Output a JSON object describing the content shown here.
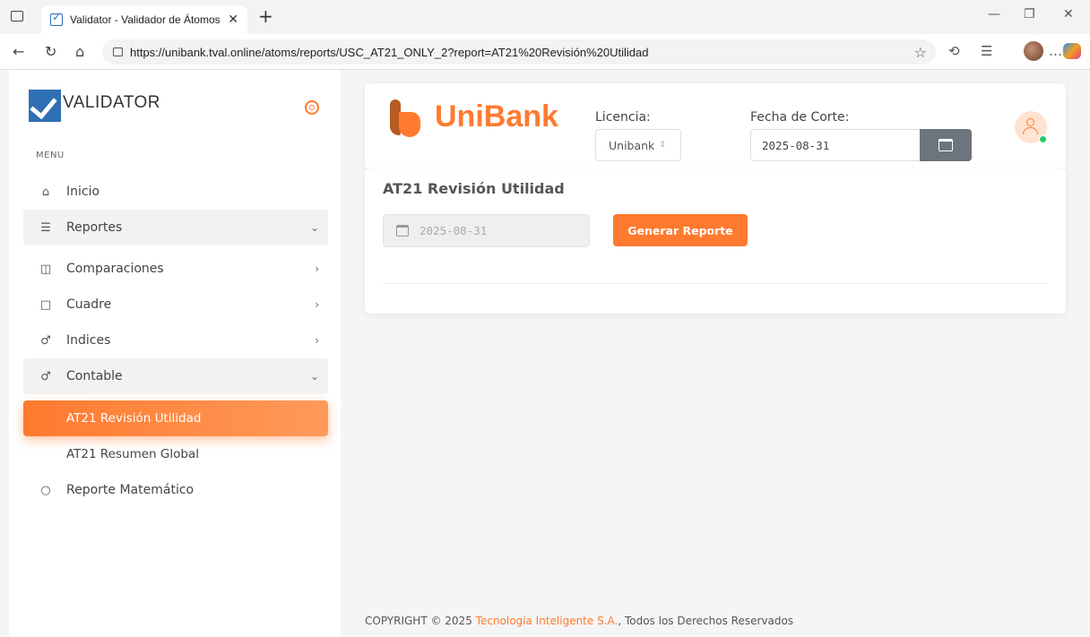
{
  "browser": {
    "tab_title": "Validator - Validador de Átomos",
    "tab_close": "✕",
    "new_tab": "+",
    "url": "https://unibank.tval.online/atoms/reports/USC_AT21_ONLY_2?report=AT21%20Revisión%20Utilidad"
  },
  "sidebar": {
    "logo_text": "VALIDATOR",
    "menu_label": "MENU",
    "items": [
      {
        "label": "Inicio",
        "icon": "home-icon"
      },
      {
        "label": "Reportes",
        "icon": "database-icon"
      },
      {
        "label": "Comparaciones",
        "icon": "columns-icon"
      },
      {
        "label": "Cuadre",
        "icon": "square-icon"
      },
      {
        "label": "Indices",
        "icon": "gender-icon"
      },
      {
        "label": "Contable",
        "icon": "gender-icon"
      },
      {
        "label": "AT21 Revisión Utilidad"
      },
      {
        "label": "AT21 Resumen Global"
      },
      {
        "label": "Reporte Matemático",
        "icon": "circle-icon"
      }
    ]
  },
  "header": {
    "brand": "UniBank",
    "licencia_label": "Licencia:",
    "licencia_value": "Unibank",
    "fecha_label": "Fecha de Corte:",
    "fecha_value": "2025-08-31"
  },
  "report": {
    "title": "AT21 Revisión Utilidad",
    "date_value": "2025-08-31",
    "generate_label": "Generar Reporte"
  },
  "footer": {
    "prefix": "COPYRIGHT © 2025",
    "company": "Tecnología Inteligente S.A.",
    "suffix": ", Todos los Derechos Reservados"
  },
  "colors": {
    "accent": "#ff7a2f",
    "sidebar_logo": "#2f6fb3",
    "online": "#28c76f"
  }
}
